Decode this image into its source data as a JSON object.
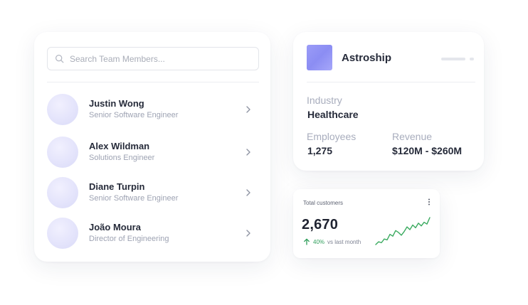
{
  "team": {
    "search_placeholder": "Search Team Members...",
    "members": [
      {
        "name": "Justin Wong",
        "role": "Senior Software Engineer"
      },
      {
        "name": "Alex Wildman",
        "role": "Solutions Engineer"
      },
      {
        "name": "Diane Turpin",
        "role": "Senior Software Engineer"
      },
      {
        "name": "João Moura",
        "role": "Director of Engineering"
      }
    ]
  },
  "company": {
    "name": "Astroship",
    "industry_label": "Industry",
    "industry_value": "Healthcare",
    "employees_label": "Employees",
    "employees_value": "1,275",
    "revenue_label": "Revenue",
    "revenue_value": "$120M - $260M"
  },
  "customers": {
    "title": "Total customers",
    "value": "2,670",
    "change_pct": "40%",
    "change_text": "vs last month",
    "trend_series": [
      3,
      6,
      5,
      9,
      8,
      14,
      12,
      18,
      16,
      13,
      17,
      22,
      19,
      24,
      21,
      26,
      23,
      27,
      25,
      32
    ],
    "trend_color": "#3aaa5f"
  },
  "colors": {
    "accent": "#8b8df3",
    "text_primary": "#262b3a",
    "text_muted": "#9ea3b3",
    "positive": "#2f9e5b"
  },
  "icons": {
    "search": "search-icon",
    "chevron": "chevron-right-icon",
    "kebab": "more-vertical-icon",
    "trend": "arrow-up-icon"
  }
}
